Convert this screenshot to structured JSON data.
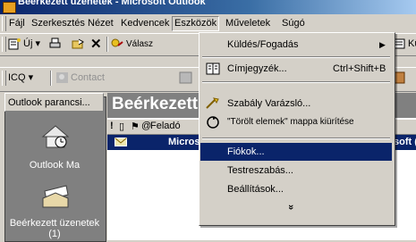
{
  "window": {
    "title": "Beérkezett üzenetek - Microsoft Outlook"
  },
  "menubar": {
    "items": [
      "Fájl",
      "Szerkesztés",
      "Nézet",
      "Kedvencek",
      "Eszközök",
      "Műveletek",
      "Súgó"
    ]
  },
  "toolbar1": {
    "new_label": "Új",
    "reply_label": "Válasz",
    "right_partial": "Kü"
  },
  "toolbar2": {
    "icq_label": "ICQ",
    "contact_label": "Contact"
  },
  "leftpane": {
    "header": "Outlook parancsi...",
    "shortcuts": [
      {
        "label": "Outlook Ma"
      },
      {
        "label": "Beérkezett üzenetek (1)"
      }
    ]
  },
  "main": {
    "folder_title": "Beérkezett",
    "column_sender": "Feladó",
    "row_sender": "Micros",
    "row_partial": "soft ("
  },
  "tools_menu": {
    "items": [
      {
        "label": "Küldés/Fogadás",
        "shortcut": "",
        "has_submenu": true
      },
      {
        "label": "Címjegyzék...",
        "shortcut": "Ctrl+Shift+B"
      },
      {
        "label": "Szabály Varázsló...",
        "shortcut": ""
      },
      {
        "label": "\"Törölt elemek\" mappa kiürítése",
        "shortcut": ""
      },
      {
        "label": "Fiókok...",
        "shortcut": "",
        "highlighted": true
      },
      {
        "label": "Testreszabás...",
        "shortcut": ""
      },
      {
        "label": "Beállítások...",
        "shortcut": ""
      }
    ],
    "more_glyph": "»"
  },
  "colors": {
    "highlight": "#0a246a",
    "face": "#d4d0c8",
    "pane": "#808080"
  }
}
